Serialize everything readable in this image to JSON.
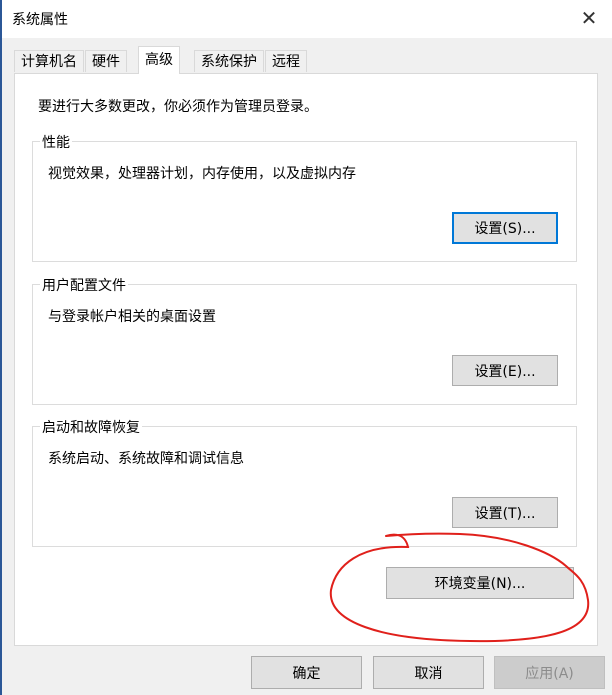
{
  "window": {
    "title": "系统属性"
  },
  "tabs": [
    {
      "label": "计算机名"
    },
    {
      "label": "硬件"
    },
    {
      "label": "高级"
    },
    {
      "label": "系统保护"
    },
    {
      "label": "远程"
    }
  ],
  "note": "要进行大多数更改，你必须作为管理员登录。",
  "groups": {
    "performance": {
      "label": "性能",
      "desc": "视觉效果，处理器计划，内存使用，以及虚拟内存",
      "button": "设置(S)..."
    },
    "profile": {
      "label": "用户配置文件",
      "desc": "与登录帐户相关的桌面设置",
      "button": "设置(E)..."
    },
    "startup": {
      "label": "启动和故障恢复",
      "desc": "系统启动、系统故障和调试信息",
      "button": "设置(T)..."
    }
  },
  "env_button": "环境变量(N)...",
  "footer": {
    "ok": "确定",
    "cancel": "取消",
    "apply": "应用(A)"
  },
  "colors": {
    "annotation": "#e0201b",
    "focus": "#0078d7",
    "accent_edge": "#2b5797"
  }
}
